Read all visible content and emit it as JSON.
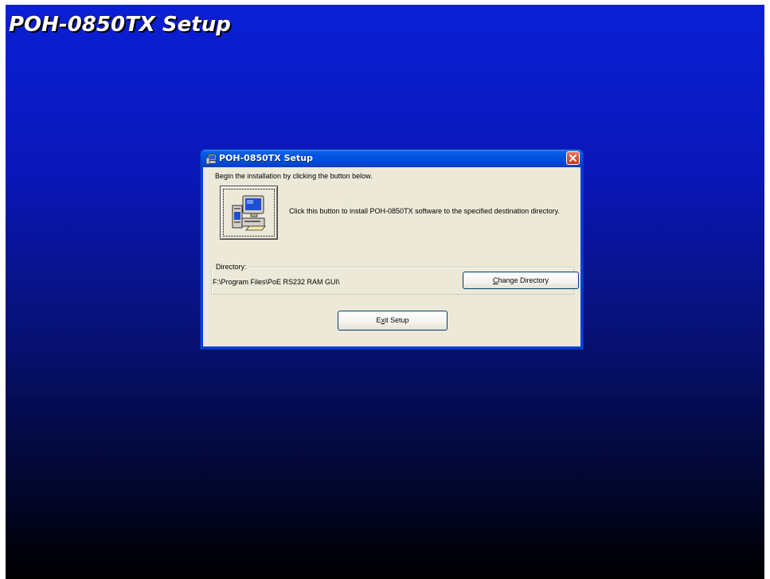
{
  "background": {
    "title": "POH-0850TX Setup"
  },
  "dialog": {
    "title": "POH-0850TX Setup",
    "title_icon": "setup-computer-icon",
    "close_icon": "close-icon",
    "instruction": "Begin the installation by clicking the button below.",
    "install_button_icon": "install-computer-icon",
    "install_description": "Click this button to install POH-0850TX software to the specified destination directory.",
    "directory": {
      "label": "Directory:",
      "path": "F:\\Program Files\\PoE RS232 RAM GUI\\",
      "change_button": {
        "mnemonic": "C",
        "rest": "hange Directory"
      }
    },
    "exit_button": {
      "prefix": "E",
      "mnemonic": "x",
      "rest": "it Setup"
    }
  },
  "colors": {
    "desktop_top": "#0a1fd6",
    "desktop_bottom": "#000000",
    "titlebar": "#0052e0",
    "dialog_face": "#ece9d8",
    "close_button": "#d5502f"
  }
}
